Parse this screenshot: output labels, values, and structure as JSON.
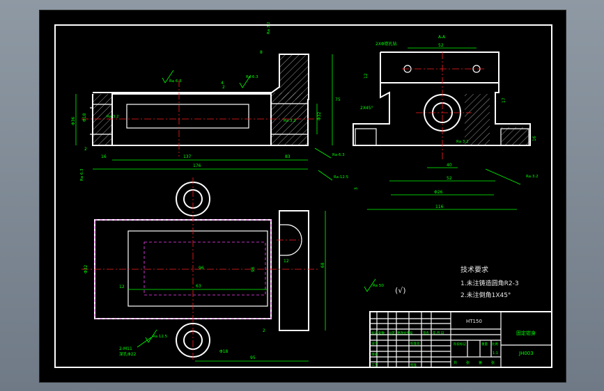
{
  "drawing": {
    "title_block": {
      "part_name": "固定钳身",
      "material": "HT150",
      "drawing_no": "JH003",
      "scale": "1:1",
      "row_labels": [
        "标记",
        "设计",
        "审核",
        "工艺"
      ],
      "col_labels": [
        "处数",
        "分区",
        "更改文件号",
        "签名",
        "年.月.日"
      ],
      "stage_label": "阶段标记",
      "weight_label": "重量",
      "scale_label": "比例",
      "sheet_labels": [
        "共",
        "张",
        "第",
        "张"
      ],
      "std_label": "标准化",
      "approve_label": "批准"
    },
    "tech_requirements": {
      "heading": "技术要求",
      "lines": [
        "1.未注铸造圆角R2-3",
        "2.未注倒角1X45°"
      ]
    },
    "roughness_general": {
      "value": "Ra 50",
      "symbol": "(√)"
    },
    "front_view": {
      "dims": [
        "176",
        "137",
        "83",
        "16",
        "2",
        "75",
        "Φ32",
        "Φ36",
        "Φ18",
        "4",
        "2",
        "8"
      ],
      "roughness": [
        "Ra 6.3",
        "Ra 6.3",
        "Ra 3.2",
        "Ra 3.2",
        "Ra 3.2",
        "Ra 6.3",
        "Ra 12.5",
        "Ra 6.3"
      ]
    },
    "side_view": {
      "section_label": "A-A",
      "hole_note": "2XΦ锪孔钻",
      "chamfer_note": "2X45°",
      "dims": [
        "52",
        "12",
        "17",
        "40",
        "52",
        "Φ26",
        "116",
        "16",
        "3"
      ],
      "roughness": [
        "Ra 3.2",
        "Ra 3.2"
      ]
    },
    "top_view": {
      "dims": [
        "Φ32",
        "12",
        "68",
        "96",
        "63",
        "95",
        "12",
        "Φ18",
        "2",
        "96"
      ],
      "thread_note": "2-M11",
      "thread_sub": "深孔Φ22",
      "roughness": [
        "Ra 12.5"
      ]
    }
  }
}
